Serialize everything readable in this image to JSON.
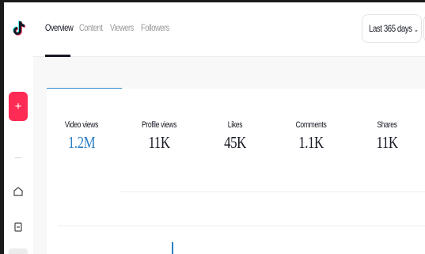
{
  "app": {
    "logo_icon": "tiktok-logo-icon",
    "accent_color": "#fe2c55",
    "selected_color": "#2a7ec4"
  },
  "sidebar": {
    "create_label": "+",
    "icons": [
      "home-icon",
      "content-icon"
    ]
  },
  "header": {
    "tabs": [
      {
        "label": "Overview",
        "active": true
      },
      {
        "label": "Content",
        "active": false
      },
      {
        "label": "Viewers",
        "active": false
      },
      {
        "label": "Followers",
        "active": false
      }
    ],
    "date_range": {
      "label": "Last 365 days",
      "icon": "chevron-down-icon"
    }
  },
  "metrics": [
    {
      "label": "Video views",
      "value": "1.2M",
      "selected": true
    },
    {
      "label": "Profile views",
      "value": "11K",
      "selected": false
    },
    {
      "label": "Likes",
      "value": "45K",
      "selected": false
    },
    {
      "label": "Comments",
      "value": "1.1K",
      "selected": false
    },
    {
      "label": "Shares",
      "value": "11K",
      "selected": false
    }
  ]
}
